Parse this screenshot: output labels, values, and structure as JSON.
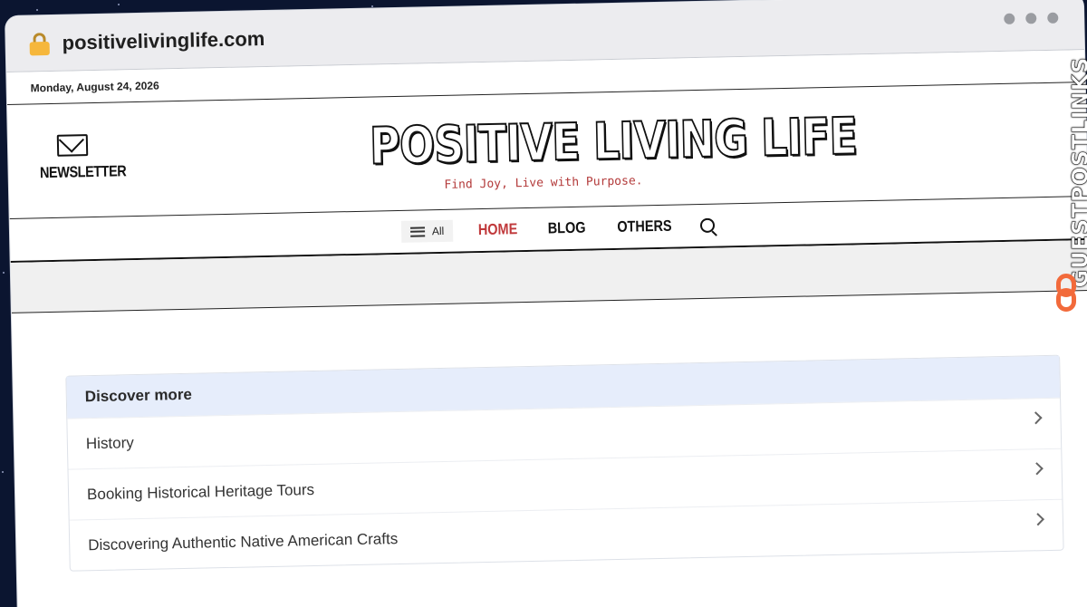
{
  "browser": {
    "url": "positivelivinglife.com",
    "lock_icon": "lock-icon"
  },
  "site": {
    "date": "Monday, August 24, 2026",
    "newsletter_label": "NEWSLETTER",
    "title": "POSITIVE LIVING LIFE",
    "tagline": "Find Joy, Live with Purpose.",
    "brand_color": "#c0393b"
  },
  "nav": {
    "all_label": "All",
    "items": [
      {
        "label": "HOME",
        "active": true
      },
      {
        "label": "BLOG",
        "active": false
      },
      {
        "label": "OTHERS",
        "active": false
      }
    ]
  },
  "discover": {
    "heading": "Discover more",
    "items": [
      {
        "label": "History"
      },
      {
        "label": "Booking Historical Heritage Tours"
      },
      {
        "label": "Discovering Authentic Native American Crafts"
      }
    ]
  },
  "watermark": {
    "text": "GUESTPOSTLINKS",
    "accent": "#f26a3b"
  }
}
